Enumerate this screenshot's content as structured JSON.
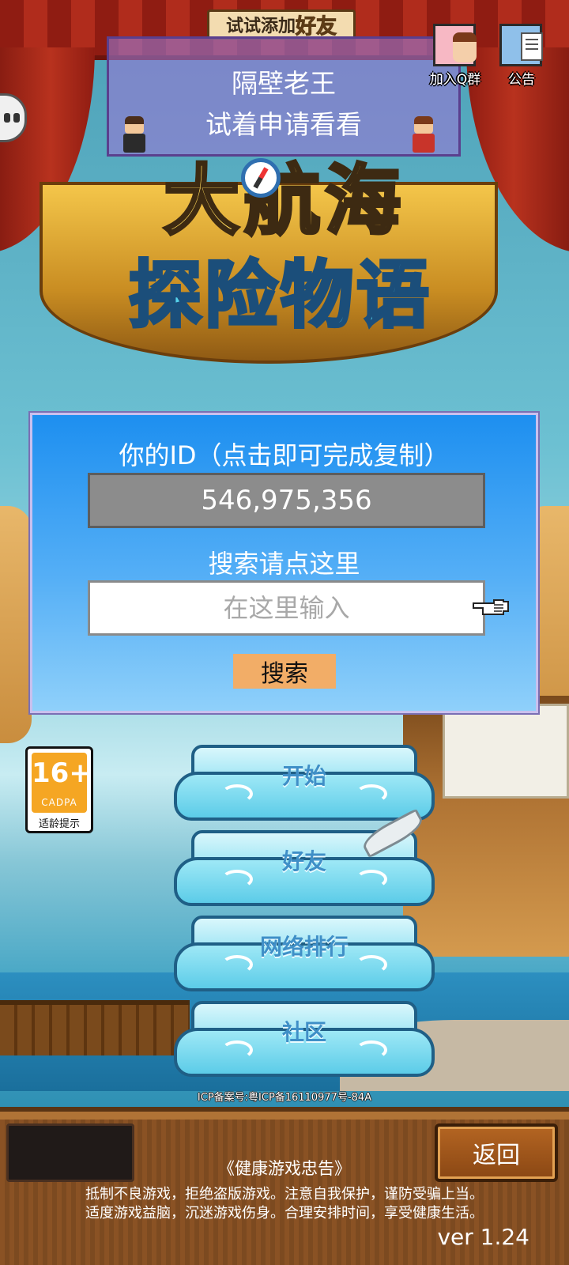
{
  "top": {
    "add_friend_prefix": "试试添加",
    "add_friend_highlight": "好友",
    "qgroup_label": "加入Q群",
    "notice_label": "公告"
  },
  "suggestion": {
    "name": "隔壁老王",
    "hint": "试着申请看看"
  },
  "logo": {
    "line1": "大航海",
    "line2": "探险物语"
  },
  "id_panel": {
    "title": "你的ID（点击即可完成复制）",
    "id_value": "546,975,356",
    "search_title": "搜索请点这里",
    "search_placeholder": "在这里输入",
    "search_value": "",
    "search_button": "搜索"
  },
  "age_badge": {
    "rating": "16+",
    "org": "CADPA",
    "tip": "适龄提示"
  },
  "menu": [
    {
      "label": "开始"
    },
    {
      "label": "好友"
    },
    {
      "label": "网络排行"
    },
    {
      "label": "社区"
    }
  ],
  "footer": {
    "icp": "ICP备案号:粤ICP备16110977号-84A",
    "back_button": "返回",
    "health_title": "《健康游戏忠告》",
    "health_line1": "抵制不良游戏，拒绝盗版游戏。注意自我保护，谨防受骗上当。",
    "health_line2": "适度游戏益脑，沉迷游戏伤身。合理安排时间，享受健康生活。",
    "version": "ver 1.24"
  }
}
